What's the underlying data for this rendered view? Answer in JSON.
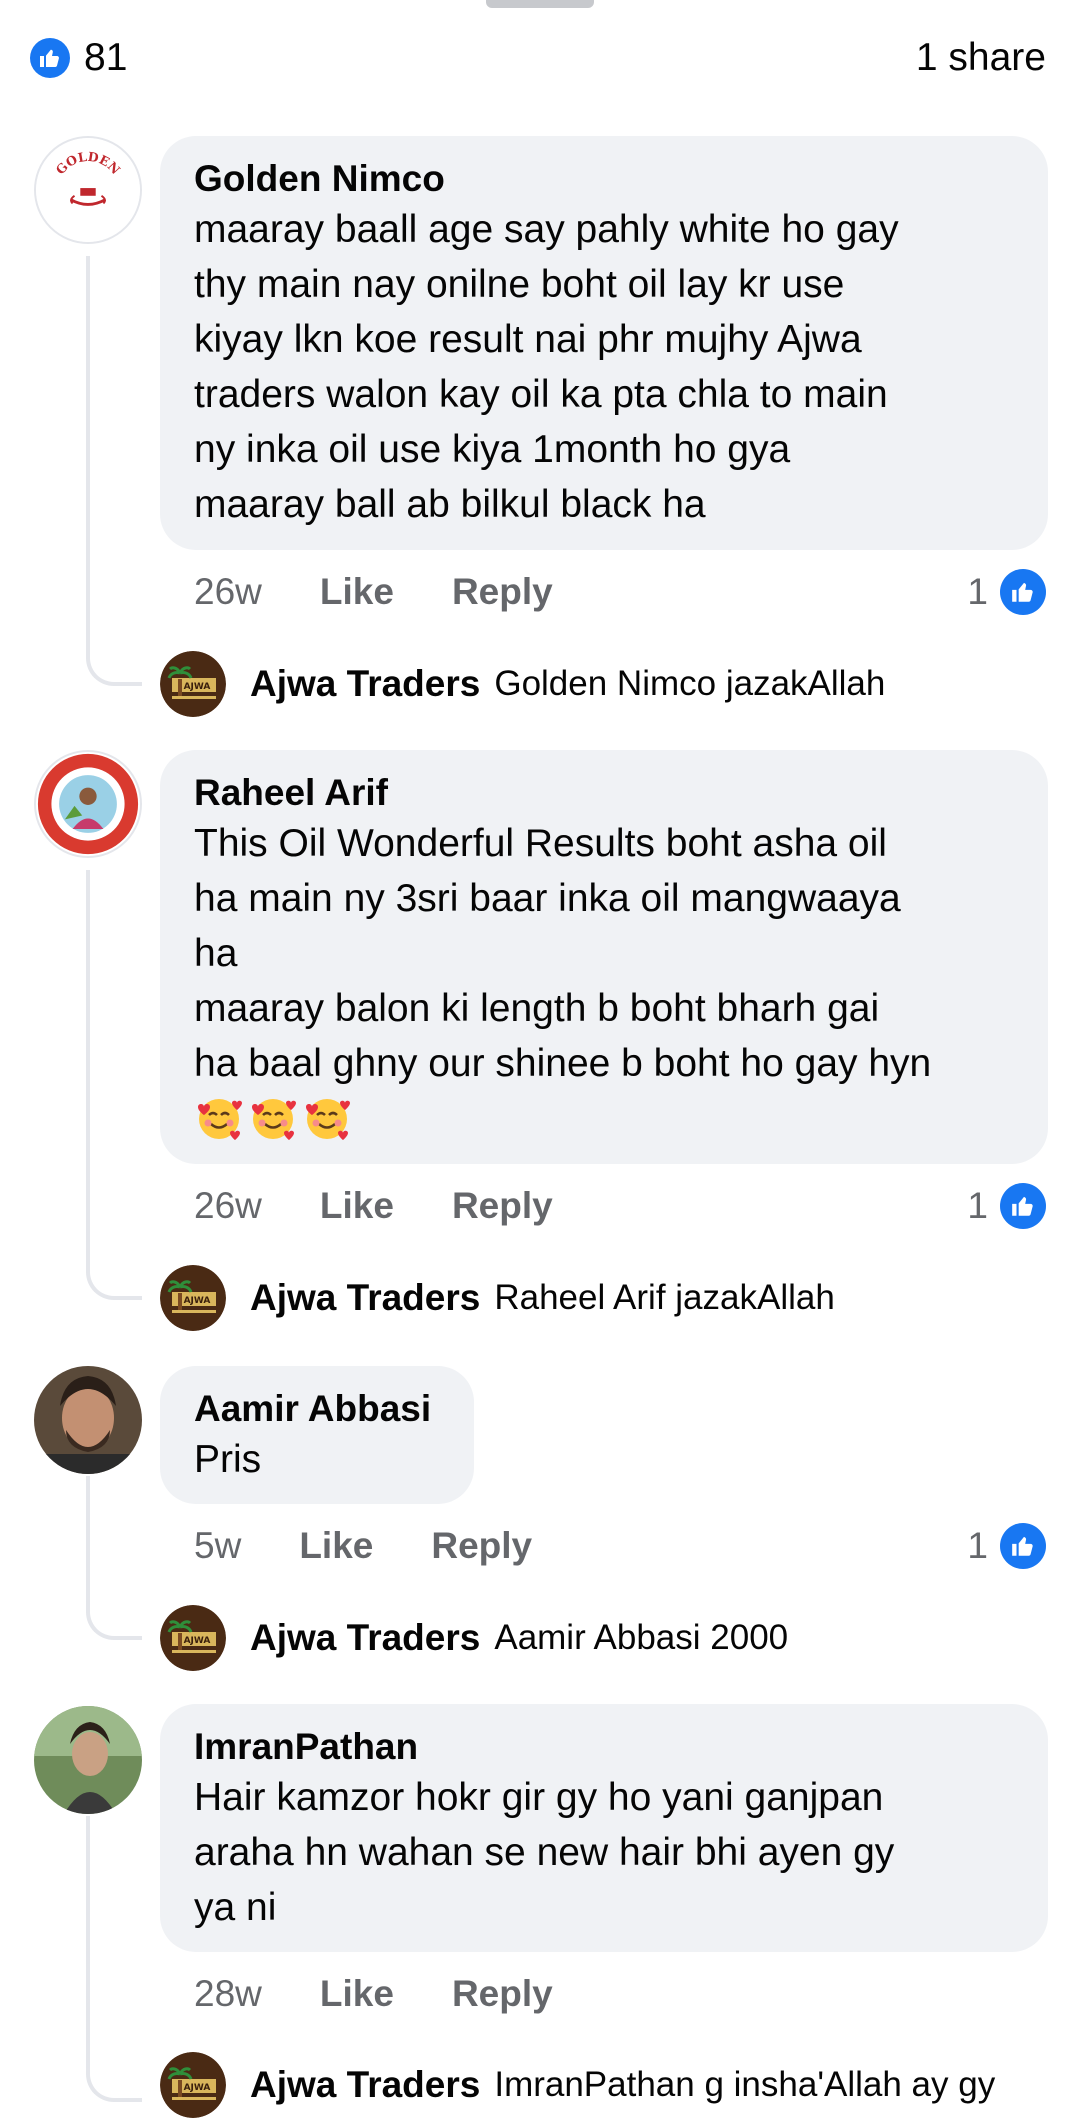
{
  "header": {
    "reactions_count": "81",
    "shares": "1 share"
  },
  "colors": {
    "accent": "#1877f2",
    "bubble": "#f0f2f5",
    "meta_text": "#65676b"
  },
  "comments": [
    {
      "author": "Golden Nimco",
      "avatar_icon": "golden-vip-logo-icon",
      "avatar_text": "GOLDEN",
      "text": "maaray baall age say pahly white ho gay\nthy main nay onilne boht oil lay kr use\nkiyay lkn koe result nai phr mujhy Ajwa\ntraders walon kay oil ka pta chla to main\nny inka oil use kiya 1month ho gya\nmaaray ball ab bilkul black ha",
      "time": "26w",
      "like_label": "Like",
      "reply_label": "Reply",
      "reaction_count": "1",
      "reply": {
        "author": "Ajwa Traders",
        "text": "Golden Nimco jazakAllah"
      }
    },
    {
      "author": "Raheel Arif",
      "avatar_icon": "raheel-arif-badge-icon",
      "text": "This Oil Wonderful Results boht asha oil\nha main ny 3sri baar inka oil mangwaaya\nha\nmaaray balon ki length b boht bharh gai\nha baal ghny our shinee b boht ho gay hyn",
      "emoji_icon": "smiling-face-with-hearts-icon",
      "time": "26w",
      "like_label": "Like",
      "reply_label": "Reply",
      "reaction_count": "1",
      "reply": {
        "author": "Ajwa Traders",
        "text": "Raheel Arif jazakAllah"
      }
    },
    {
      "author": "Aamir Abbasi",
      "avatar_icon": "user-photo-icon",
      "text": "Pris",
      "time": "5w",
      "like_label": "Like",
      "reply_label": "Reply",
      "reaction_count": "1",
      "reply": {
        "author": "Ajwa Traders",
        "text": "Aamir Abbasi 2000"
      }
    },
    {
      "author": "ImranPathan",
      "avatar_icon": "user-photo-icon",
      "text": "Hair kamzor hokr gir gy ho yani ganjpan\naraha hn wahan se new hair bhi ayen gy\nya ni",
      "time": "28w",
      "like_label": "Like",
      "reply_label": "Reply",
      "reply": {
        "author": "Ajwa Traders",
        "text": "ImranPathan g insha'Allah ay gy"
      }
    }
  ],
  "reply_avatar_text": "AJWA"
}
